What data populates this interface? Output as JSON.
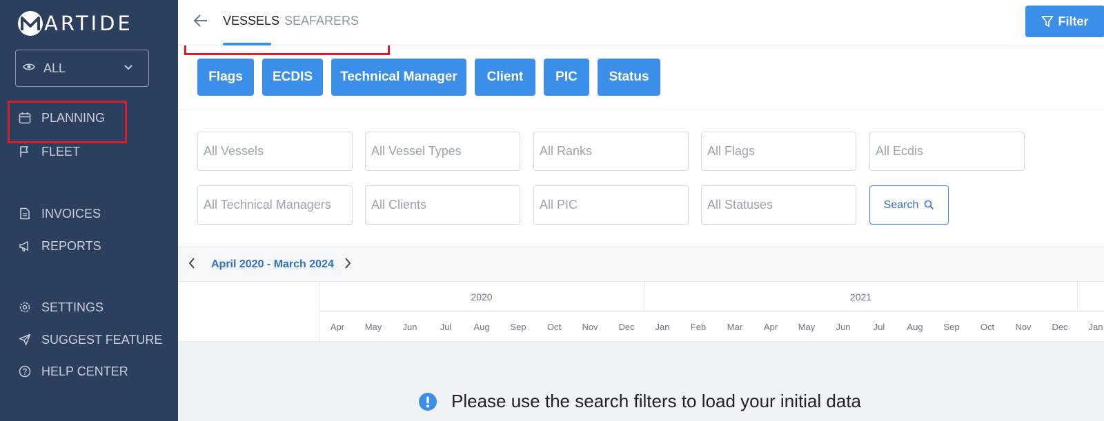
{
  "brand": {
    "letter": "M",
    "name": "ARTIDE"
  },
  "sidebar": {
    "view_select": {
      "value": "ALL",
      "icon": "eye-icon"
    },
    "items": [
      {
        "label": "PLANNING",
        "icon": "calendar-icon"
      },
      {
        "label": "FLEET",
        "icon": "flag-icon"
      },
      {
        "label": "INVOICES",
        "icon": "document-icon"
      },
      {
        "label": "REPORTS",
        "icon": "megaphone-icon"
      },
      {
        "label": "SETTINGS",
        "icon": "gear-icon"
      },
      {
        "label": "SUGGEST FEATURE",
        "icon": "send-icon"
      },
      {
        "label": "HELP CENTER",
        "icon": "help-icon"
      }
    ]
  },
  "header": {
    "tabs": [
      {
        "label": "VESSELS",
        "active": true
      },
      {
        "label": "SEAFARERS",
        "active": false
      }
    ],
    "filter_label": "Filter"
  },
  "chips": [
    "Flags",
    "ECDIS",
    "Technical Manager",
    "Client",
    "PIC",
    "Status"
  ],
  "filters": {
    "vessels": "All Vessels",
    "vessel_types": "All Vessel Types",
    "ranks": "All Ranks",
    "flags": "All Flags",
    "ecdis": "All Ecdis",
    "technical_managers": "All Technical Managers",
    "clients": "All Clients",
    "pic": "All PIC",
    "statuses": "All Statuses",
    "search_label": "Search"
  },
  "timeline": {
    "range": "April 2020 - March 2024",
    "years": [
      "2020",
      "2021"
    ],
    "months": [
      "Apr",
      "May",
      "Jun",
      "Jul",
      "Aug",
      "Sep",
      "Oct",
      "Nov",
      "Dec",
      "Jan",
      "Feb",
      "Mar",
      "Apr",
      "May",
      "Jun",
      "Jul",
      "Aug",
      "Sep",
      "Oct",
      "Nov",
      "Dec",
      "Jan"
    ]
  },
  "notice": "Please use the search filters to load your initial data",
  "colors": {
    "sidebar": "#2c3f5e",
    "accent": "#3b8fe8",
    "highlight": "#d3212d"
  }
}
